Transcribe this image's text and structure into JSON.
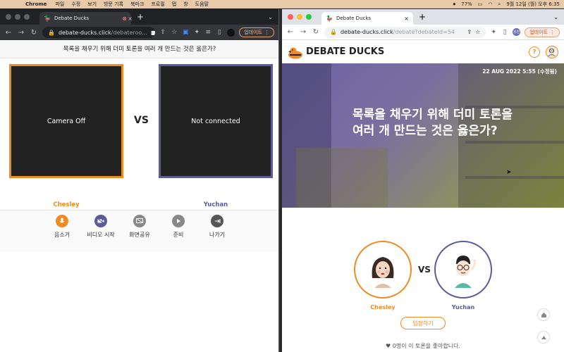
{
  "menubar": {
    "app_name": "Chrome",
    "items": [
      "파일",
      "수정",
      "보기",
      "방문 기록",
      "북마크",
      "프로필",
      "탭",
      "창",
      "도움말"
    ],
    "battery": "77%",
    "clock": "9월 12일 (월) 오후 6:35"
  },
  "left_window": {
    "tab_title": "Debate Ducks",
    "url_host": "debate-ducks.click",
    "url_path": "/debateroo...",
    "update_label": "업데이트",
    "topic": "목록을 채우기 위해 더미 토론을 여러 개 만드는 것은 옳은가?",
    "camera_left": "Camera Off",
    "camera_right": "Not connected",
    "vs": "VS",
    "player_left": "Chesley",
    "player_right": "Yuchan",
    "controls": [
      {
        "label": "음소거",
        "icon": "microphone-icon"
      },
      {
        "label": "비디오 시작",
        "icon": "video-off-icon"
      },
      {
        "label": "화면공유",
        "icon": "screen-share-icon"
      },
      {
        "label": "준비",
        "icon": "play-icon"
      },
      {
        "label": "나가기",
        "icon": "exit-icon"
      }
    ],
    "colors": {
      "pro": "#f08a24",
      "con": "#5b5b9a"
    }
  },
  "right_window": {
    "tab_title": "Debate Ducks",
    "url_host": "debate-ducks.click",
    "url_path": "/debate?debateId=54",
    "update_label": "업데이트",
    "profile_initial": "유찬",
    "logo_text": "DEBATE DUCKS",
    "help_label": "?",
    "date": "22 AUG 2022 5:55 (수정됨)",
    "title": "목록을 채우기 위해 더미 토론을 여러 개 만드는 것은 옳은가?",
    "vs": "VS",
    "player_left": "Chesley",
    "player_right": "Yuchan",
    "enter_label": "입장하기",
    "likes_text": "♥ 0명이 이 토론을 좋아합니다."
  }
}
